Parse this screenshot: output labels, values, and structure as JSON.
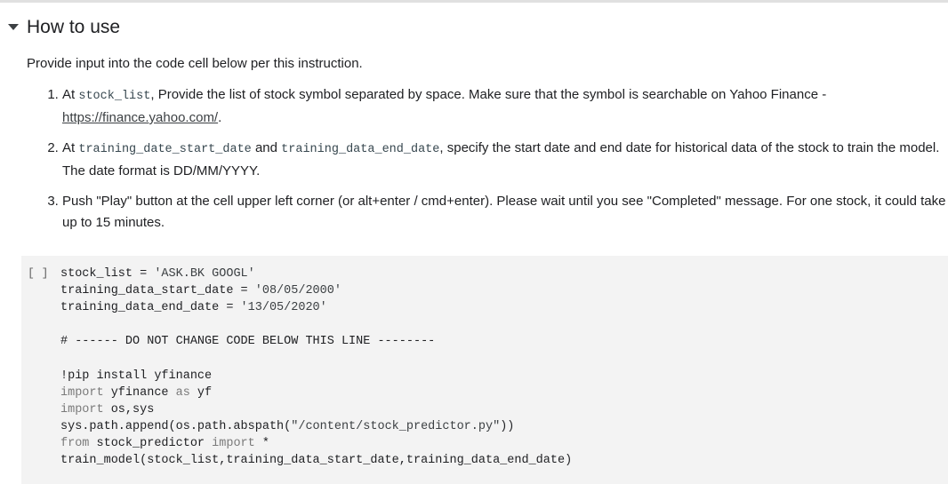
{
  "section": {
    "title": "How to use",
    "caret_icon": "caret-down-icon"
  },
  "instructions": {
    "intro": "Provide input into the code cell below per this instruction.",
    "step1": {
      "pre": "At ",
      "code1": "stock_list",
      "text": ", Provide the list of stock symbol separated by space. Make sure that the symbol is searchable on Yahoo Finance - ",
      "link": "https://finance.yahoo.com/",
      "post": "."
    },
    "step2": {
      "pre": "At ",
      "code1": "training_date_start_date",
      "mid": " and ",
      "code2": "training_data_end_date",
      "text": ", specify the start date and end date for historical data of the stock to train the model. The date format is DD/MM/YYYY."
    },
    "step3": {
      "text": "Push \"Play\" button at the cell upper left corner (or alt+enter / cmd+enter). Please wait until you see \"Completed\" message. For one stock, it could take up to 15 minutes."
    }
  },
  "code_cell": {
    "run_label": "[ ]",
    "lines": {
      "l1a": "stock_list = ",
      "l1b": "'ASK.BK GOOGL'",
      "l2a": "training_data_start_date = ",
      "l2b": "'08/05/2000'",
      "l3a": "training_data_end_date = ",
      "l3b": "'13/05/2020'",
      "l5": "# ------ DO NOT CHANGE CODE BELOW THIS LINE --------",
      "l7": "!pip install yfinance",
      "l8a": "import",
      "l8b": " yfinance ",
      "l8c": "as",
      "l8d": " yf",
      "l9a": "import",
      "l9b": " os,sys",
      "l10a": "sys.path.append(os.path.abspath(",
      "l10b": "\"/content/stock_predictor.py\"",
      "l10c": "))",
      "l11a": "from",
      "l11b": " stock_predictor ",
      "l11c": "import",
      "l11d": " *",
      "l12": "train_model(stock_list,training_data_start_date,training_data_end_date)"
    }
  }
}
